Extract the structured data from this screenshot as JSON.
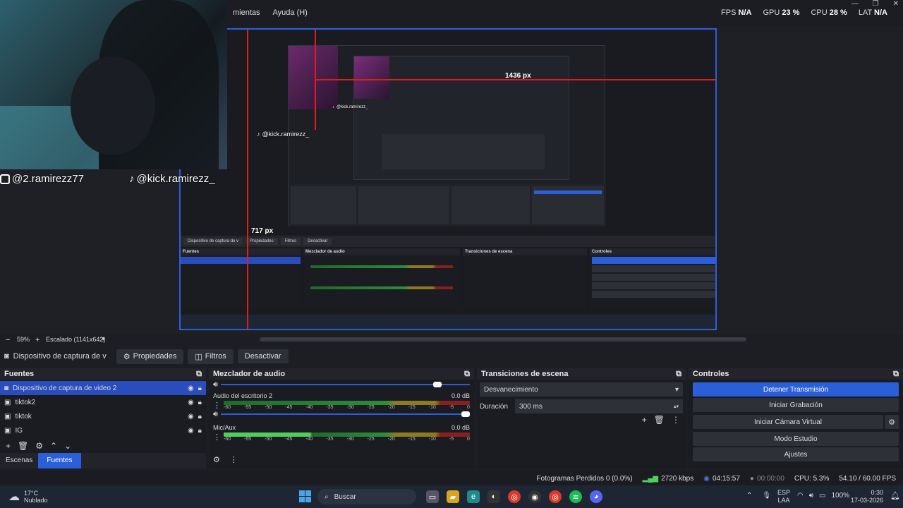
{
  "menu": [
    "mientas",
    "Ayuda (H)"
  ],
  "stats": [
    {
      "label": "FPS",
      "value": "N/A"
    },
    {
      "label": "GPU",
      "value": "23 %"
    },
    {
      "label": "CPU",
      "value": "28 %"
    },
    {
      "label": "LAT",
      "value": "N/A"
    }
  ],
  "overlay": {
    "instagram": "@2.ramirezz77",
    "tiktok": "@kick.ramirezz_",
    "inner_tiktok": "@kick.ramirezz_",
    "inner_tiktok2": "@kick.ramirezz_",
    "px_1436": "1436 px",
    "px_717": "717 px"
  },
  "zoom": {
    "minus": "−",
    "value": "59%",
    "plus": "+",
    "scale": "Escalado (1141x642)"
  },
  "source_toolbar": {
    "source_name": "Dispositivo de captura de v",
    "properties": "Propiedades",
    "filters": "Filtros",
    "deactivate": "Desactivar"
  },
  "sources": {
    "title": "Fuentes",
    "items": [
      {
        "name": "Dispositivo de captura de video 2",
        "selected": true
      },
      {
        "name": "tiktok2",
        "selected": false
      },
      {
        "name": "tiktok",
        "selected": false
      },
      {
        "name": "IG",
        "selected": false
      }
    ],
    "tabs": [
      "Escenas",
      "Fuentes"
    ]
  },
  "mixer": {
    "title": "Mezclador de audio",
    "channels": [
      {
        "name": "Audio del escritorio 2",
        "db": "0.0 dB"
      },
      {
        "name": "Mic/Aux",
        "db": "0.0 dB"
      }
    ],
    "ticks": [
      "-60",
      "-55",
      "-50",
      "-45",
      "-40",
      "-35",
      "-30",
      "-25",
      "-20",
      "-15",
      "-10",
      "-5",
      "0"
    ]
  },
  "transitions": {
    "title": "Transiciones de escena",
    "selected": "Desvanecimiento",
    "duration_label": "Duración",
    "duration_value": "300 ms"
  },
  "controls": {
    "title": "Controles",
    "buttons": [
      "Detener Transmisión",
      "Iniciar Grabación",
      "Iniciar Cámara Virtual",
      "Modo Estudio",
      "Ajustes"
    ]
  },
  "status": {
    "dropped": "Fotogramas Perdidos 0 (0.0%)",
    "bitrate": "2720 kbps",
    "stream_time": "04:15:57",
    "rec_time": "00:00:00",
    "cpu": "CPU: 5.3%",
    "fps": "54.10 / 60.00 FPS"
  },
  "taskbar": {
    "weather_temp": "17°C",
    "weather_desc": "Nublado",
    "search": "Buscar",
    "lang": "ESP",
    "lang2": "LAA",
    "battery": "100%",
    "time": "0:30",
    "date": "17-03-2026"
  },
  "colors": {
    "accent": "#2b5fd9",
    "measure_red": "#e21c1c",
    "background": "#1d1e24"
  }
}
